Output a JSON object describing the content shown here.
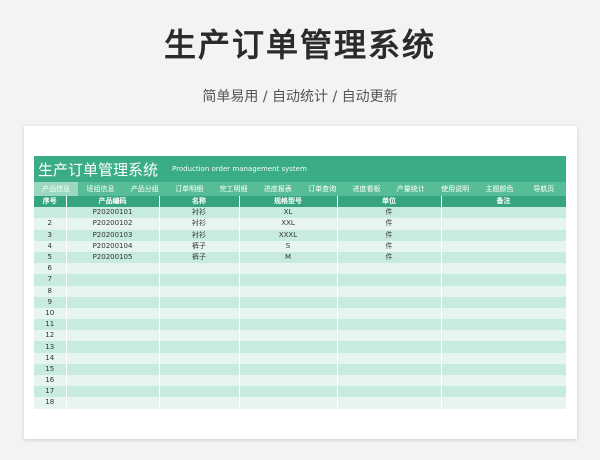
{
  "promo": {
    "title": "生产订单管理系统",
    "subtitle": "简单易用  /  自动统计  /  自动更新"
  },
  "sheet": {
    "title": "生产订单管理系统",
    "title_en": "Production order management system",
    "tabs": [
      "产品信息",
      "班组信息",
      "产品分组",
      "订单明细",
      "完工明细",
      "进度报表",
      "订单查询",
      "进度看板",
      "产量统计",
      "使用说明",
      "主题颜色",
      "导航页"
    ],
    "active_tab": 0,
    "headers": [
      "序号",
      "产品编码",
      "名称",
      "规格型号",
      "单位",
      "备注"
    ],
    "rows": [
      [
        "",
        "P20200101",
        "衬衫",
        "XL",
        "件",
        ""
      ],
      [
        "2",
        "P20200102",
        "衬衫",
        "XXL",
        "件",
        ""
      ],
      [
        "3",
        "P20200103",
        "衬衫",
        "XXXL",
        "件",
        ""
      ],
      [
        "4",
        "P20200104",
        "裤子",
        "S",
        "件",
        ""
      ],
      [
        "5",
        "P20200105",
        "裤子",
        "M",
        "件",
        ""
      ],
      [
        "6",
        "",
        "",
        "",
        "",
        ""
      ],
      [
        "7",
        "",
        "",
        "",
        "",
        ""
      ],
      [
        "8",
        "",
        "",
        "",
        "",
        ""
      ],
      [
        "9",
        "",
        "",
        "",
        "",
        ""
      ],
      [
        "10",
        "",
        "",
        "",
        "",
        ""
      ],
      [
        "11",
        "",
        "",
        "",
        "",
        ""
      ],
      [
        "12",
        "",
        "",
        "",
        "",
        ""
      ],
      [
        "13",
        "",
        "",
        "",
        "",
        ""
      ],
      [
        "14",
        "",
        "",
        "",
        "",
        ""
      ],
      [
        "15",
        "",
        "",
        "",
        "",
        ""
      ],
      [
        "16",
        "",
        "",
        "",
        "",
        ""
      ],
      [
        "17",
        "",
        "",
        "",
        "",
        ""
      ],
      [
        "18",
        "",
        "",
        "",
        "",
        ""
      ]
    ]
  }
}
